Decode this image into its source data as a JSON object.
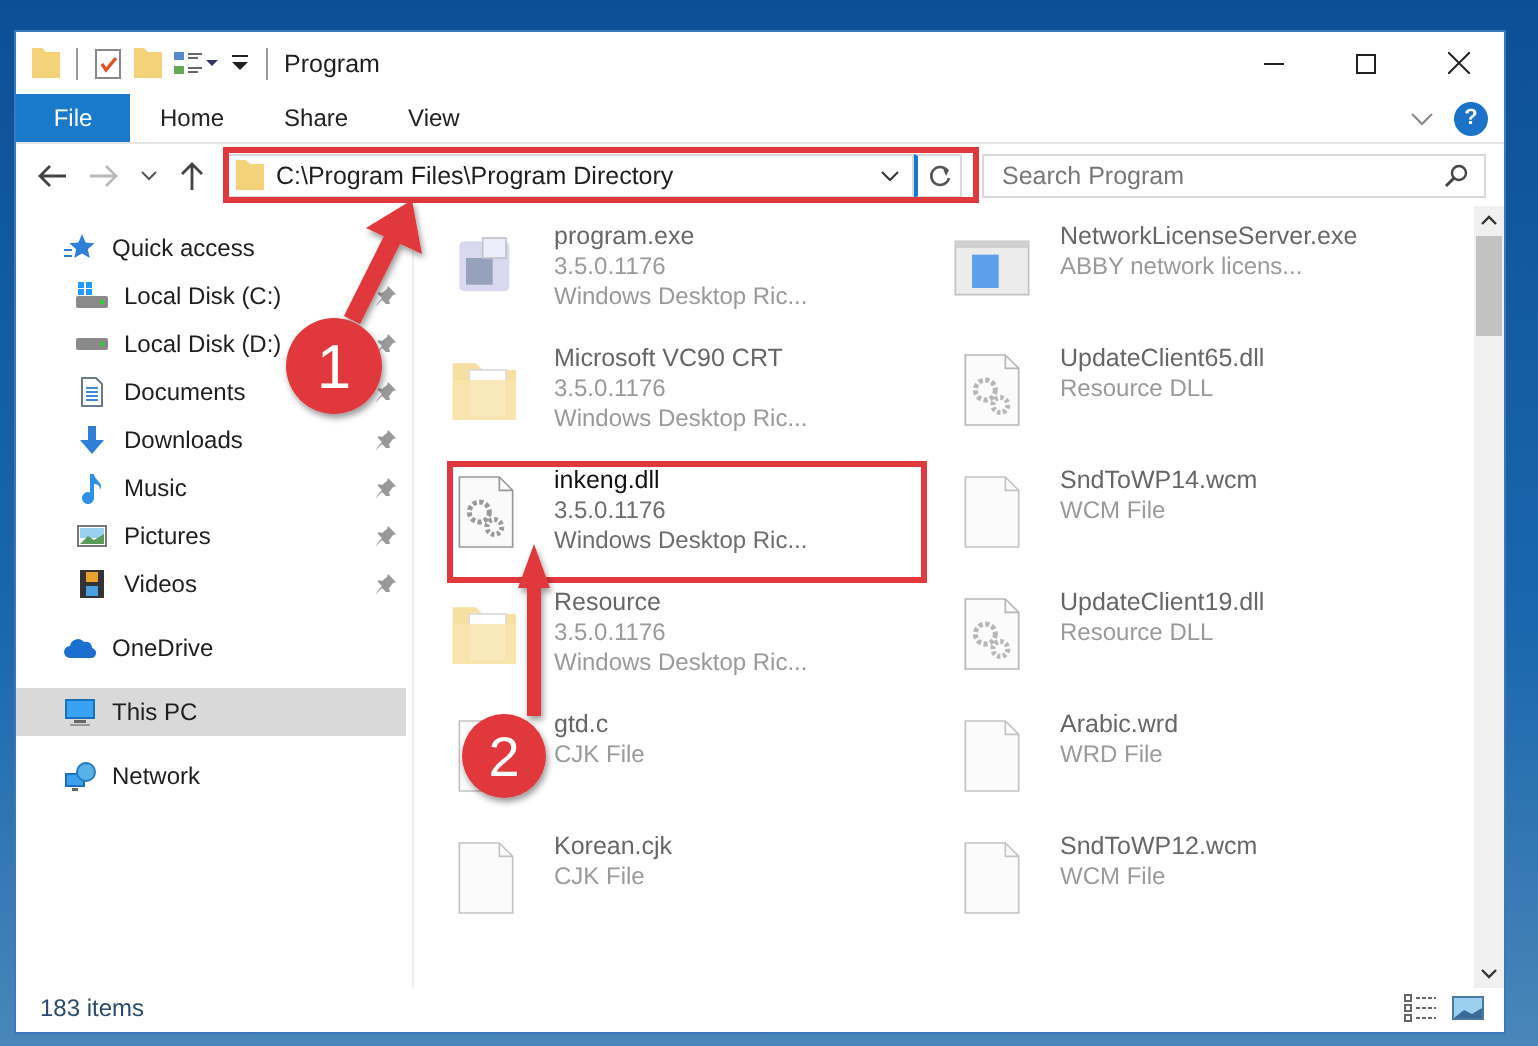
{
  "window": {
    "title": "Program"
  },
  "ribbon": {
    "tabs": [
      {
        "label": "File",
        "kind": "file"
      },
      {
        "label": "Home",
        "kind": "tab"
      },
      {
        "label": "Share",
        "kind": "tab"
      },
      {
        "label": "View",
        "kind": "tab"
      }
    ],
    "help": "?"
  },
  "address_bar": {
    "path": "C:\\Program Files\\Program Directory"
  },
  "search": {
    "placeholder": "Search Program"
  },
  "sidebar": {
    "items": [
      {
        "label": "Quick access",
        "selected": false,
        "children": [
          {
            "label": "Local Disk (C:)",
            "pinned": true,
            "selected": false
          },
          {
            "label": "Local Disk (D:)",
            "pinned": true,
            "selected": false
          },
          {
            "label": "Documents",
            "pinned": true,
            "selected": false
          },
          {
            "label": "Downloads",
            "pinned": true,
            "selected": false
          },
          {
            "label": "Music",
            "pinned": true,
            "selected": false
          },
          {
            "label": "Pictures",
            "pinned": true,
            "selected": false
          },
          {
            "label": "Videos",
            "pinned": true,
            "selected": false
          }
        ]
      },
      {
        "label": "OneDrive",
        "selected": false
      },
      {
        "label": "This PC",
        "selected": true
      },
      {
        "label": "Network",
        "selected": false
      }
    ]
  },
  "files": [
    {
      "name": "program.exe",
      "details": [
        "3.5.0.1176",
        "Windows Desktop Ric..."
      ],
      "kind": "app",
      "blurred": true
    },
    {
      "name": "NetworkLicenseServer.exe",
      "details": [
        "ABBY network licens..."
      ],
      "kind": "window",
      "blurred": true
    },
    {
      "name": "Microsoft VC90 CRT",
      "details": [
        "3.5.0.1176",
        "Windows Desktop Ric..."
      ],
      "kind": "folder",
      "blurred": true
    },
    {
      "name": "UpdateClient65.dll",
      "details": [
        "Resource DLL"
      ],
      "kind": "dll",
      "blurred": true
    },
    {
      "name": "inkeng.dll",
      "details": [
        "3.5.0.1176",
        "Windows Desktop Ric..."
      ],
      "kind": "dll",
      "blurred": false
    },
    {
      "name": "SndToWP14.wcm",
      "details": [
        "WCM File"
      ],
      "kind": "blank",
      "blurred": true
    },
    {
      "name": "Resource",
      "details": [
        "3.5.0.1176",
        "Windows Desktop Ric..."
      ],
      "kind": "folder",
      "blurred": true
    },
    {
      "name": "UpdateClient19.dll",
      "details": [
        "Resource DLL"
      ],
      "kind": "dll",
      "blurred": true
    },
    {
      "name": "gtd.c",
      "details": [
        "CJK File"
      ],
      "kind": "blank",
      "blurred": true
    },
    {
      "name": "Arabic.wrd",
      "details": [
        "WRD File"
      ],
      "kind": "blank",
      "blurred": true
    },
    {
      "name": "Korean.cjk",
      "details": [
        "CJK File"
      ],
      "kind": "blank",
      "blurred": true
    },
    {
      "name": "SndToWP12.wcm",
      "details": [
        "WCM File"
      ],
      "kind": "blank",
      "blurred": true
    }
  ],
  "status_bar": {
    "item_count": "183 items"
  },
  "annotations": [
    {
      "label": "1"
    },
    {
      "label": "2"
    }
  ]
}
